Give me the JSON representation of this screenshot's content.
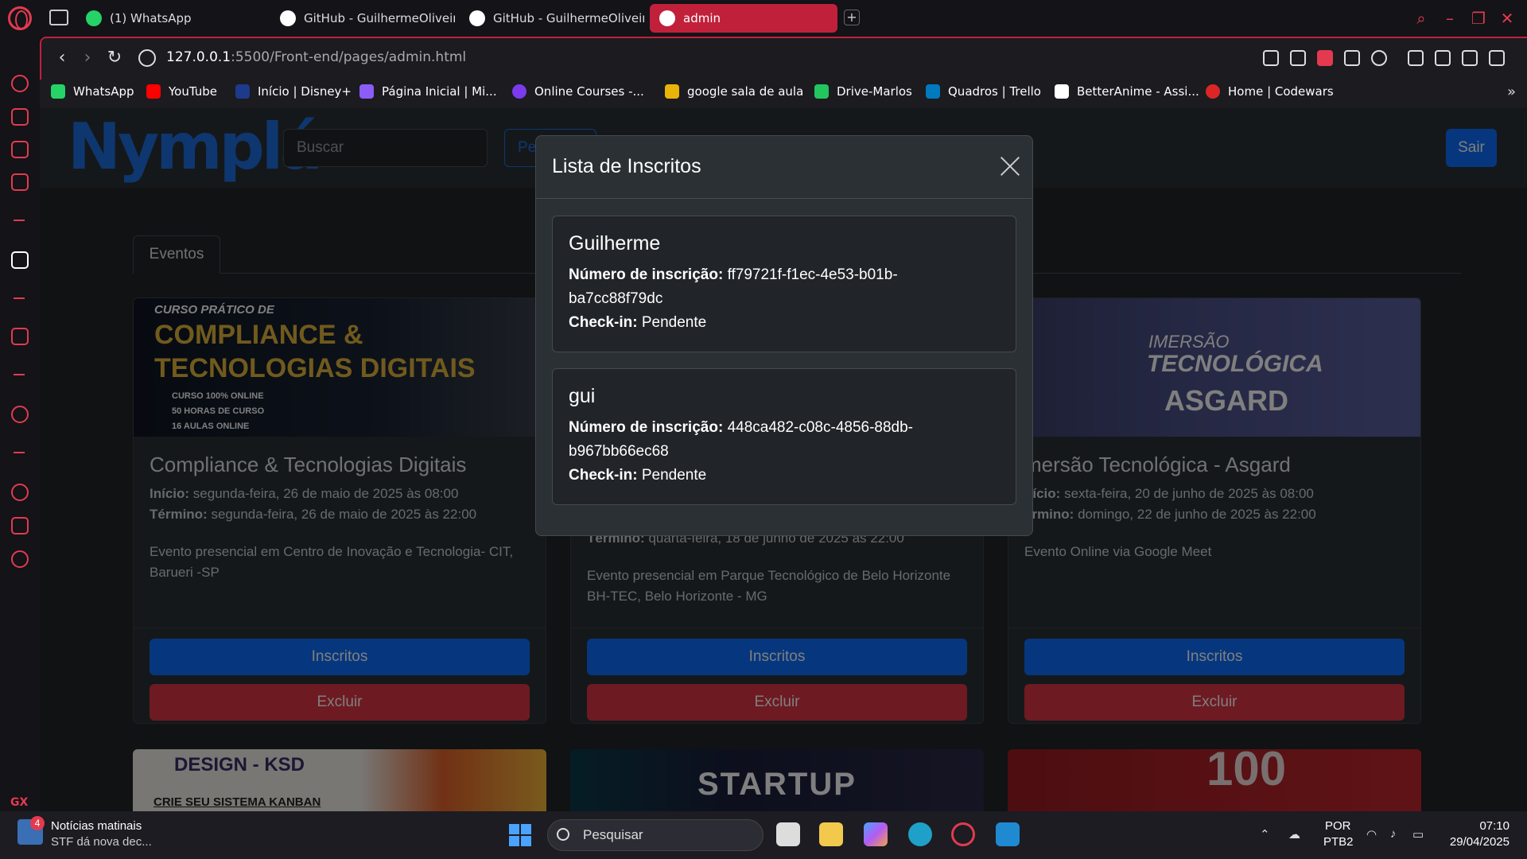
{
  "browser": {
    "tabs": [
      {
        "label": "(1) WhatsApp",
        "icon": "whatsapp-icon"
      },
      {
        "label": "GitHub - GuilhermeOliveir",
        "icon": "github-icon"
      },
      {
        "label": "GitHub - GuilhermeOliveir",
        "icon": "github-icon"
      },
      {
        "label": "admin",
        "icon": "opera-icon",
        "active": true
      }
    ],
    "url_host": "127.0.0.1",
    "url_path": ":5500/Front-end/pages/admin.html",
    "accent": "#c1203b"
  },
  "bookmarks": [
    {
      "label": "WhatsApp",
      "color": "#25d366"
    },
    {
      "label": "YouTube",
      "color": "#ff0000"
    },
    {
      "label": "Início | Disney+",
      "color": "#1e3a8a"
    },
    {
      "label": "Página Inicial | Mi...",
      "color": "#8b5cf6"
    },
    {
      "label": "Online Courses -...",
      "color": "#7c3aed"
    },
    {
      "label": "google sala de aula",
      "color": "#eab308"
    },
    {
      "label": "Drive-Marlos",
      "color": "#22c55e"
    },
    {
      "label": "Quadros | Trello",
      "color": "#0079bf"
    },
    {
      "label": "BetterAnime - Assi...",
      "color": "#ffffff"
    },
    {
      "label": "Home | Codewars",
      "color": "#dc2626"
    }
  ],
  "navbar": {
    "logo": "Nymplá",
    "search_placeholder": "Buscar",
    "search_button": "Pesquisar",
    "logout": "Sair"
  },
  "tab_label": "Eventos",
  "events": [
    {
      "title": "Compliance & Tecnologias Digitais",
      "start_label": "Início:",
      "start": "segunda-feira, 26 de maio de 2025 às 08:00",
      "end_label": "Término:",
      "end": "segunda-feira, 26 de maio de 2025 às 22:00",
      "desc": "Evento presencial em Centro de Inovação e Tecnologia- CIT, Barueri -SP",
      "banner_small": "CURSO PRÁTICO DE",
      "banner_big1": "COMPLIANCE &",
      "banner_big2": "TECNOLOGIAS DIGITAIS",
      "banner_l1": "CURSO 100% ONLINE",
      "banner_l2": "50 HORAS DE CURSO",
      "banner_l3": "16 AULAS ONLINE"
    },
    {
      "end_label": "Término:",
      "end": "quarta-feira, 18 de junho de 2025 às 22:00",
      "desc": "Evento presencial em Parque Tecnológico de Belo Horizonte BH-TEC, Belo Horizonte - MG"
    },
    {
      "title": "mersão Tecnológica - Asgard",
      "start_label": "nício:",
      "start": "sexta-feira, 20 de junho de 2025 às 08:00",
      "end_label": "érmino:",
      "end": "domingo, 22 de junho de 2025 às 22:00",
      "desc": "Evento Online via Google Meet",
      "banner_l1": "IMERSÃO",
      "banner_l2": "TECNOLÓGICA",
      "banner_l3": "ASGARD"
    }
  ],
  "buttons": {
    "subscribers": "Inscritos",
    "delete": "Excluir"
  },
  "bottom_banners": [
    "DESIGN - KSD",
    "CRIE SEU SISTEMA KANBAN",
    "STARTUP",
    "100"
  ],
  "modal": {
    "title": "Lista de Inscritos",
    "reg_label": "Número de inscrição:",
    "checkin_label": "Check-in:",
    "subscribers": [
      {
        "name": "Guilherme",
        "id_line1": "ff79721f-f1ec-4e53-b01b-",
        "id_line2": "ba7cc88f79dc",
        "checkin": "Pendente"
      },
      {
        "name": "gui",
        "id_line1": "448ca482-c08c-4856-88db-",
        "id_line2": "b967bb66ec68",
        "checkin": "Pendente"
      }
    ]
  },
  "taskbar": {
    "news_title": "Notícias matinais",
    "news_sub": "STF dá nova dec...",
    "news_badge": "4",
    "search": "Pesquisar",
    "lang": "POR",
    "kb": "PTB2",
    "time": "07:10",
    "date": "29/04/2025"
  }
}
